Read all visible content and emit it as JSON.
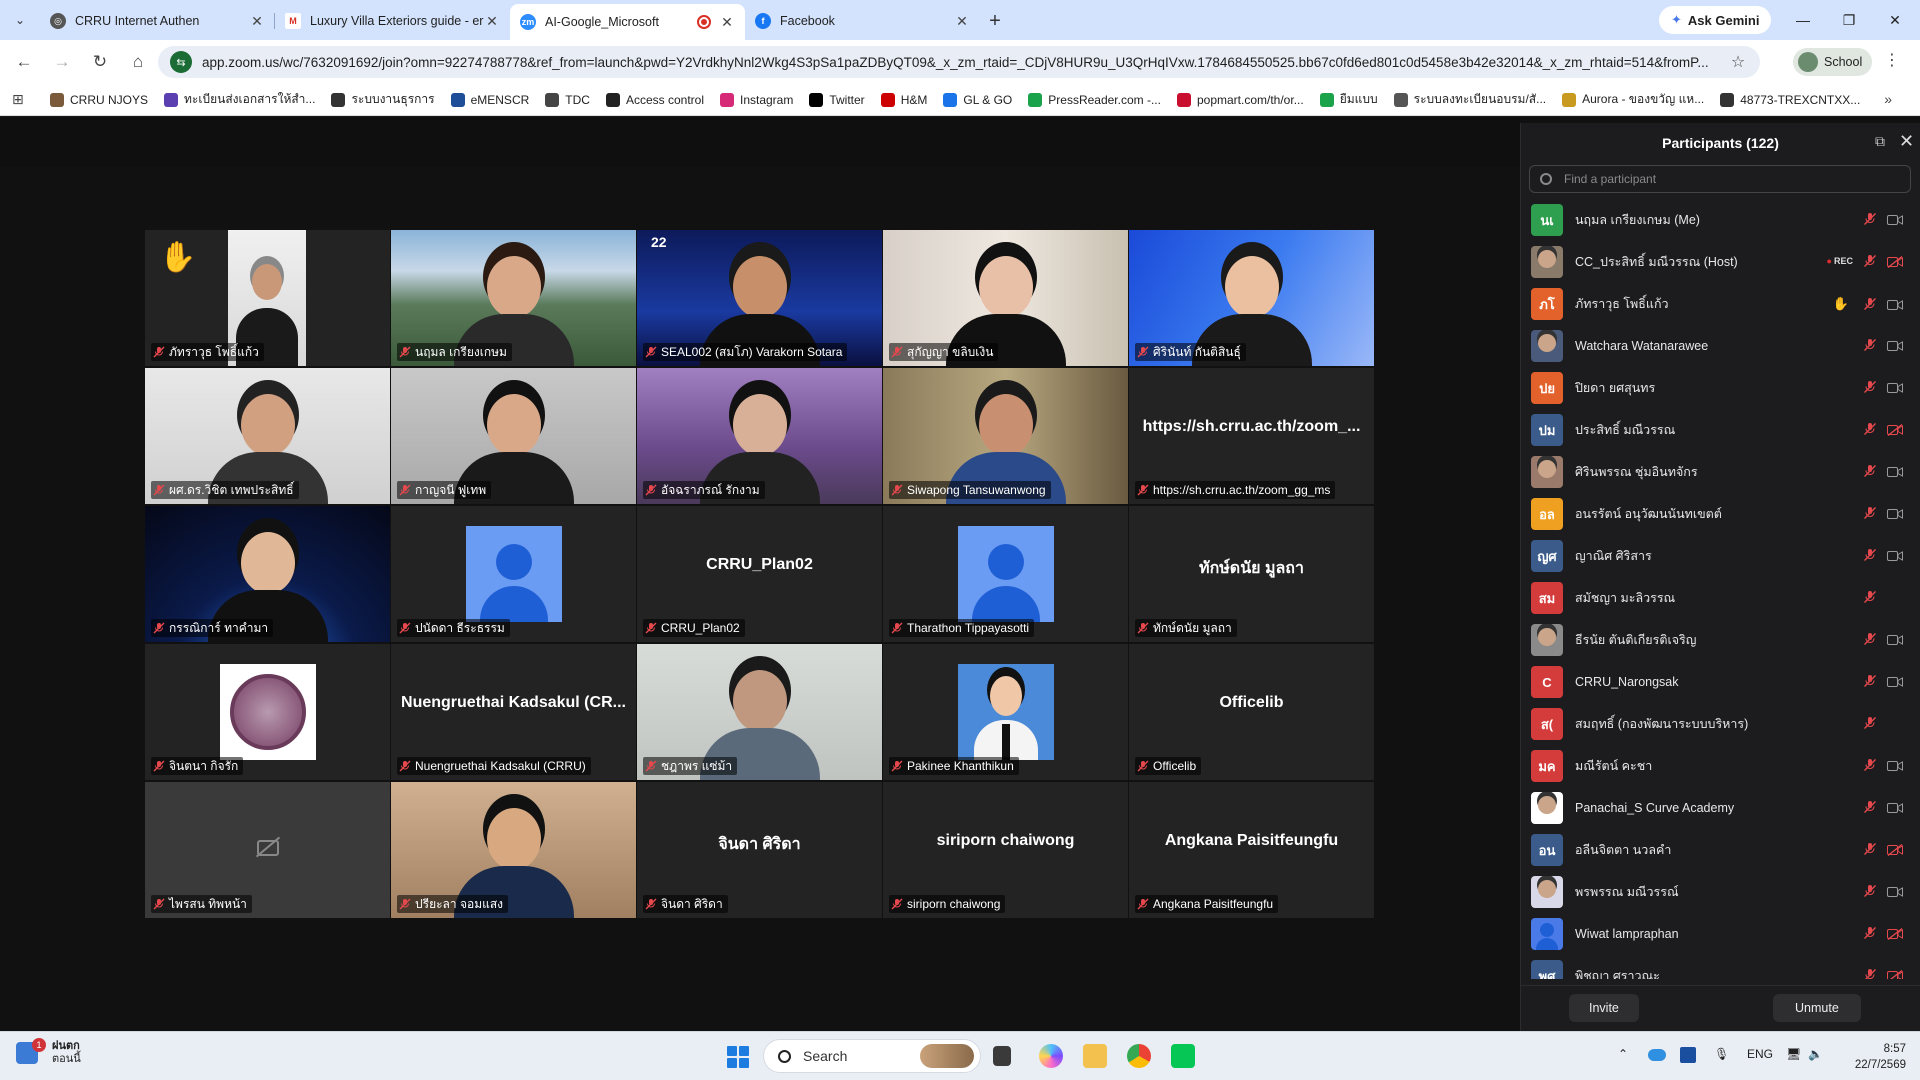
{
  "browser": {
    "tabs": [
      {
        "title": "CRRU Internet Authen",
        "favicon": "globe-icon",
        "active": false
      },
      {
        "title": "Luxury Villa Exteriors guide - er",
        "favicon": "gmail-icon",
        "active": false
      },
      {
        "title": "AI-Google_Microsoft",
        "favicon": "zoom-icon",
        "active": true
      },
      {
        "title": "Facebook",
        "favicon": "facebook-icon",
        "active": false
      }
    ],
    "new_tab": "+",
    "gemini_label": "Ask Gemini",
    "url": "app.zoom.us/wc/7632091692/join?omn=92274788778&ref_from=launch&pwd=Y2VrdkhyNnl2Wkg4S3pSa1paZDByQT09&_x_zm_rtaid=_CDjV8HUR9u_U3QrHqIVxw.1784684550525.bb67c0fd6ed801c0d5458e3b42e32014&_x_zm_rhtaid=514&fromP...",
    "profile_label": "School",
    "bookmarks": [
      "CRRU NJOYS",
      "ทะเบียนส่งเอกสารให้สำ...",
      "ระบบงานธุรการ",
      "eMENSCR",
      "TDC",
      "Access control",
      "Instagram",
      "Twitter",
      "H&M",
      "GL & GO",
      "PressReader.com -...",
      "popmart.com/th/or...",
      "ยืมแบบ",
      "ระบบลงทะเบียนอบรม/สั...",
      "Aurora - ของขวัญ แห...",
      "48773-TREXCNTXX..."
    ]
  },
  "tiles": [
    {
      "label": "ภัทราวุธ โพธิ์แก้ว",
      "kind": "video",
      "raised_hand": true,
      "scene": "man-small"
    },
    {
      "label": "นฤมล เกรียงเกษม",
      "kind": "video",
      "scene": "mountain-woman"
    },
    {
      "label": "SEAL002 (สมโภ) Varakorn Sotara",
      "kind": "video",
      "scene": "blue-screen-man",
      "bg_date": "22"
    },
    {
      "label": "สุกัญญา ขลิบเงิน",
      "kind": "video",
      "scene": "woman-light"
    },
    {
      "label": "ศิรินันท์ กันติสินธุ์",
      "kind": "video",
      "scene": "ai-presenter",
      "active_speaker": true
    },
    {
      "label": "ผศ.ดร.วิชิต เทพประสิทธิ์",
      "kind": "video",
      "scene": "man-glasses-office"
    },
    {
      "label": "กาญจนี ฟูเทพ",
      "kind": "video",
      "scene": "woman-gray"
    },
    {
      "label": "อัจฉราภรณ์ รักงาม",
      "kind": "video",
      "scene": "woman-purple"
    },
    {
      "label": "Siwapong Tansuwanwong",
      "kind": "video",
      "scene": "man-bookshelf"
    },
    {
      "label": "https://sh.crru.ac.th/zoom_gg_ms",
      "kind": "name",
      "bigname": "https://sh.crru.ac.th/zoom_..."
    },
    {
      "label": "กรรณิการ์ ทาคำมา",
      "kind": "video",
      "scene": "space-woman"
    },
    {
      "label": "ปนัดดา ธีระธรรม",
      "kind": "avatar"
    },
    {
      "label": "CRRU_Plan02",
      "kind": "name",
      "bigname": "CRRU_Plan02"
    },
    {
      "label": "Tharathon Tippayasotti",
      "kind": "avatar"
    },
    {
      "label": "ทักษ์ดนัย มูลถา",
      "kind": "name",
      "bigname": "ทักษ์ดนัย มูลถา"
    },
    {
      "label": "จินตนา กิจรัก",
      "kind": "logo"
    },
    {
      "label": "Nuengruethai Kadsakul (CRRU)",
      "kind": "name",
      "bigname": "Nuengruethai Kadsakul (CR..."
    },
    {
      "label": "ชฎาพร แซ่ม้า",
      "kind": "video",
      "scene": "woman-pale"
    },
    {
      "label": "Pakinee Khanthikun",
      "kind": "photo"
    },
    {
      "label": "Officelib",
      "kind": "name",
      "bigname": "Officelib"
    },
    {
      "label": "ไพรสน ทิพหน้า",
      "kind": "camoff"
    },
    {
      "label": "ปรียะลา จอมแสง",
      "kind": "video",
      "scene": "man-headset"
    },
    {
      "label": "จินดา ศิริดา",
      "kind": "name",
      "bigname": "จินดา ศิริดา"
    },
    {
      "label": "siriporn chaiwong",
      "kind": "name",
      "bigname": "siriporn chaiwong"
    },
    {
      "label": "Angkana Paisitfeungfu",
      "kind": "name",
      "bigname": "Angkana Paisitfeungfu"
    }
  ],
  "participants_panel": {
    "title": "Participants (122)",
    "search_placeholder": "Find a participant",
    "items": [
      {
        "name": "นฤมล เกรียงเกษม (Me)",
        "initials": "นเ",
        "color": "#2e9e4f",
        "cam": "on"
      },
      {
        "name": "CC_ประสิทธิ์ มณีวรรณ (Host)",
        "initials": "",
        "color": "#8a7a6a",
        "photo": true,
        "rec": "REC",
        "cam": "off"
      },
      {
        "name": "ภัทราวุธ โพธิ์แก้ว",
        "initials": "ภโ",
        "color": "#e3622b",
        "hand": true,
        "cam": "on"
      },
      {
        "name": "Watchara Watanarawee",
        "initials": "",
        "color": "#4a5a7a",
        "photo": true,
        "cam": "on"
      },
      {
        "name": "ปิยดา ยศสุนทร",
        "initials": "ปย",
        "color": "#e3622b",
        "cam": "on"
      },
      {
        "name": "ประสิทธิ์ มณีวรรณ",
        "initials": "ปม",
        "color": "#3b5c8a",
        "cam": "off"
      },
      {
        "name": "ศิรินพรรณ ชุ่มอินทจักร",
        "initials": "",
        "color": "#9a7a6a",
        "photo": true,
        "cam": "on"
      },
      {
        "name": "อนรรัตน์ อนุวัฒนนันทเขตต์",
        "initials": "อล",
        "color": "#f0a020",
        "cam": "on"
      },
      {
        "name": "ญาณิศ ศิริสาร",
        "initials": "ญศ",
        "color": "#3b5c8a",
        "cam": "on"
      },
      {
        "name": "สมัชญา มะลิวรรณ",
        "initials": "สม",
        "color": "#d43c3c",
        "cam": "none"
      },
      {
        "name": "ธีรนัย ตันติเกียรติเจริญ",
        "initials": "",
        "color": "#8a8a8a",
        "photo": true,
        "cam": "on"
      },
      {
        "name": "CRRU_Narongsak",
        "initials": "C",
        "color": "#d43c3c",
        "cam": "on"
      },
      {
        "name": "สมฤทธิ์ (กองพัฒนาระบบบริหาร)",
        "initials": "ส(",
        "color": "#d43c3c",
        "cam": "none"
      },
      {
        "name": "มณีรัตน์ คะชา",
        "initials": "มค",
        "color": "#d43c3c",
        "cam": "on"
      },
      {
        "name": "Panachai_S Curve Academy",
        "initials": "",
        "color": "#ffffff",
        "photo": true,
        "cam": "on"
      },
      {
        "name": "อลีนจิตตา นวลคำ",
        "initials": "อน",
        "color": "#3b5c8a",
        "cam": "off"
      },
      {
        "name": "พรพรรณ มณีวรรณ์",
        "initials": "",
        "color": "#d8d8e8",
        "photo": true,
        "cam": "on"
      },
      {
        "name": "Wiwat lampraphan",
        "initials": "",
        "color": "#4a7ae8",
        "avatar": true,
        "cam": "off"
      },
      {
        "name": "พิชญา ศราวณะ",
        "initials": "พศ",
        "color": "#3b5c8a",
        "cam": "off"
      }
    ],
    "invite_label": "Invite",
    "unmute_label": "Unmute"
  },
  "taskbar": {
    "weather_line1": "ฝนตก",
    "weather_line2": "ตอนนี้",
    "notif_count": "1",
    "search_label": "Search",
    "lang": "ENG",
    "time": "8:57",
    "date": "22/7/2569"
  },
  "colors": {
    "active_speaker": "#2fd15c",
    "mute_red": "#e5484d",
    "panel_bg": "#1c1c1e"
  }
}
